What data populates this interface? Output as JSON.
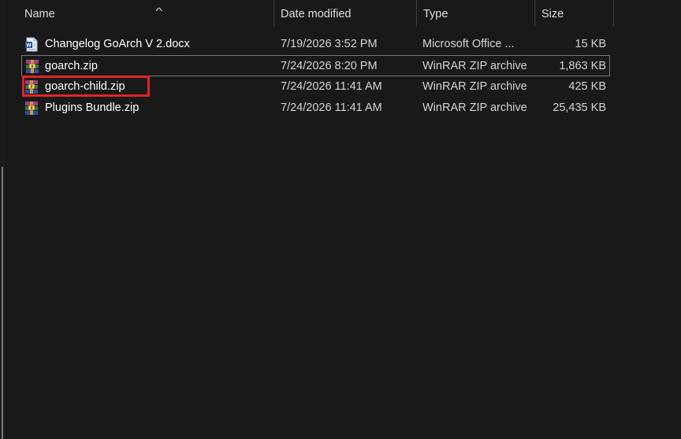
{
  "columns": {
    "name": "Name",
    "date": "Date modified",
    "type": "Type",
    "size": "Size"
  },
  "sort": {
    "column": "name",
    "direction": "ascending",
    "icon": "chevron-up-icon"
  },
  "files": [
    {
      "name": "Changelog GoArch V 2.docx",
      "date": "7/19/2026 3:52 PM",
      "type": "Microsoft Office ...",
      "size": "15 KB",
      "icon": "word-document-icon",
      "selected": false
    },
    {
      "name": "goarch.zip",
      "date": "7/24/2026 8:20 PM",
      "type": "WinRAR ZIP archive",
      "size": "1,863 KB",
      "icon": "winrar-archive-icon",
      "selected": true
    },
    {
      "name": "goarch-child.zip",
      "date": "7/24/2026 11:41 AM",
      "type": "WinRAR ZIP archive",
      "size": "425 KB",
      "icon": "winrar-archive-icon",
      "selected": false,
      "highlighted": true
    },
    {
      "name": "Plugins Bundle.zip",
      "date": "7/24/2026 11:41 AM",
      "type": "WinRAR ZIP archive",
      "size": "25,435 KB",
      "icon": "winrar-archive-icon",
      "selected": false
    }
  ],
  "colors": {
    "background": "#191919",
    "text": "#ffffff",
    "header_text": "#dedede",
    "highlight": "#e02424",
    "selection_border": "#777777"
  }
}
